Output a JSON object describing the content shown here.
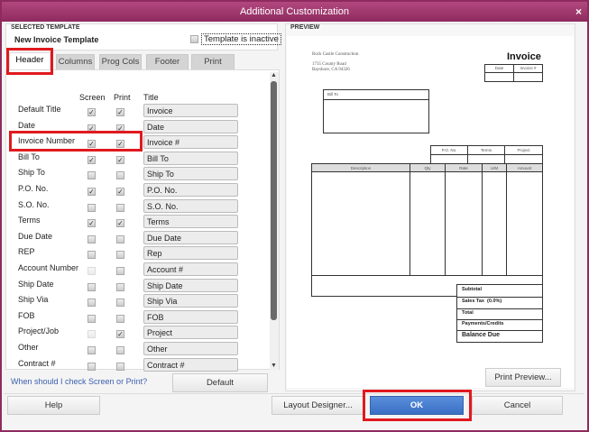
{
  "window": {
    "title": "Additional Customization",
    "close": "×"
  },
  "selected_template": {
    "label": "SELECTED TEMPLATE",
    "name": "New Invoice Template",
    "inactive_label": "Template is inactive",
    "inactive": false
  },
  "tabs": [
    {
      "label": "Header",
      "active": true
    },
    {
      "label": "Columns"
    },
    {
      "label": "Prog Cols"
    },
    {
      "label": "Footer"
    },
    {
      "label": "Print"
    }
  ],
  "columns": {
    "screen": "Screen",
    "print": "Print",
    "title": "Title"
  },
  "rows": [
    {
      "label": "Default Title",
      "screen": true,
      "print": true,
      "title": "Invoice"
    },
    {
      "label": "Date",
      "screen": true,
      "print": true,
      "title": "Date"
    },
    {
      "label": "Invoice Number",
      "screen": true,
      "print": true,
      "title": "Invoice #"
    },
    {
      "label": "Bill To",
      "screen": true,
      "print": true,
      "title": "Bill To"
    },
    {
      "label": "Ship To",
      "screen": false,
      "print": false,
      "title": "Ship To"
    },
    {
      "label": "P.O. No.",
      "screen": true,
      "print": true,
      "title": "P.O. No."
    },
    {
      "label": "S.O. No.",
      "screen": false,
      "print": false,
      "title": "S.O. No."
    },
    {
      "label": "Terms",
      "screen": true,
      "print": true,
      "title": "Terms"
    },
    {
      "label": "Due Date",
      "screen": false,
      "print": false,
      "title": "Due Date"
    },
    {
      "label": "REP",
      "screen": false,
      "print": false,
      "title": "Rep"
    },
    {
      "label": "Account Number",
      "screen": false,
      "screen_disabled": true,
      "print": false,
      "title": "Account #"
    },
    {
      "label": "Ship Date",
      "screen": false,
      "print": false,
      "title": "Ship Date"
    },
    {
      "label": "Ship Via",
      "screen": false,
      "print": false,
      "title": "Ship Via"
    },
    {
      "label": "FOB",
      "screen": false,
      "print": false,
      "title": "FOB"
    },
    {
      "label": "Project/Job",
      "screen": false,
      "screen_disabled": true,
      "print": true,
      "title": "Project"
    },
    {
      "label": "Other",
      "screen": false,
      "print": false,
      "title": "Other"
    },
    {
      "label": "Contract #",
      "screen": false,
      "print": false,
      "title": "Contract #"
    }
  ],
  "help_link": "When should I check Screen or Print?",
  "buttons": {
    "default": "Default",
    "help": "Help",
    "layout_designer": "Layout Designer...",
    "ok": "OK",
    "cancel": "Cancel",
    "print_preview": "Print Preview..."
  },
  "preview": {
    "label": "PREVIEW",
    "company": "Rock Castle Construction",
    "address1": "1735 County Road",
    "address2": "Bayshore, CA 94326",
    "doc_title": "Invoice",
    "date_h": "Date",
    "invno_h": "Invoice #",
    "bill_to": "Bill To",
    "po_h": "P.O. No.",
    "terms_h": "Terms",
    "project_h": "Project",
    "cols": [
      "Description",
      "Qty",
      "Rate",
      "U/M",
      "Amount"
    ],
    "totals": [
      "Subtotal",
      "Sales Tax  (0.0%)",
      "Total",
      "Payments/Credits",
      "Balance Due"
    ]
  },
  "colors": {
    "title_bar": "#8e2a5e",
    "ok": "#3a73c8",
    "highlight": "#e0191e"
  }
}
